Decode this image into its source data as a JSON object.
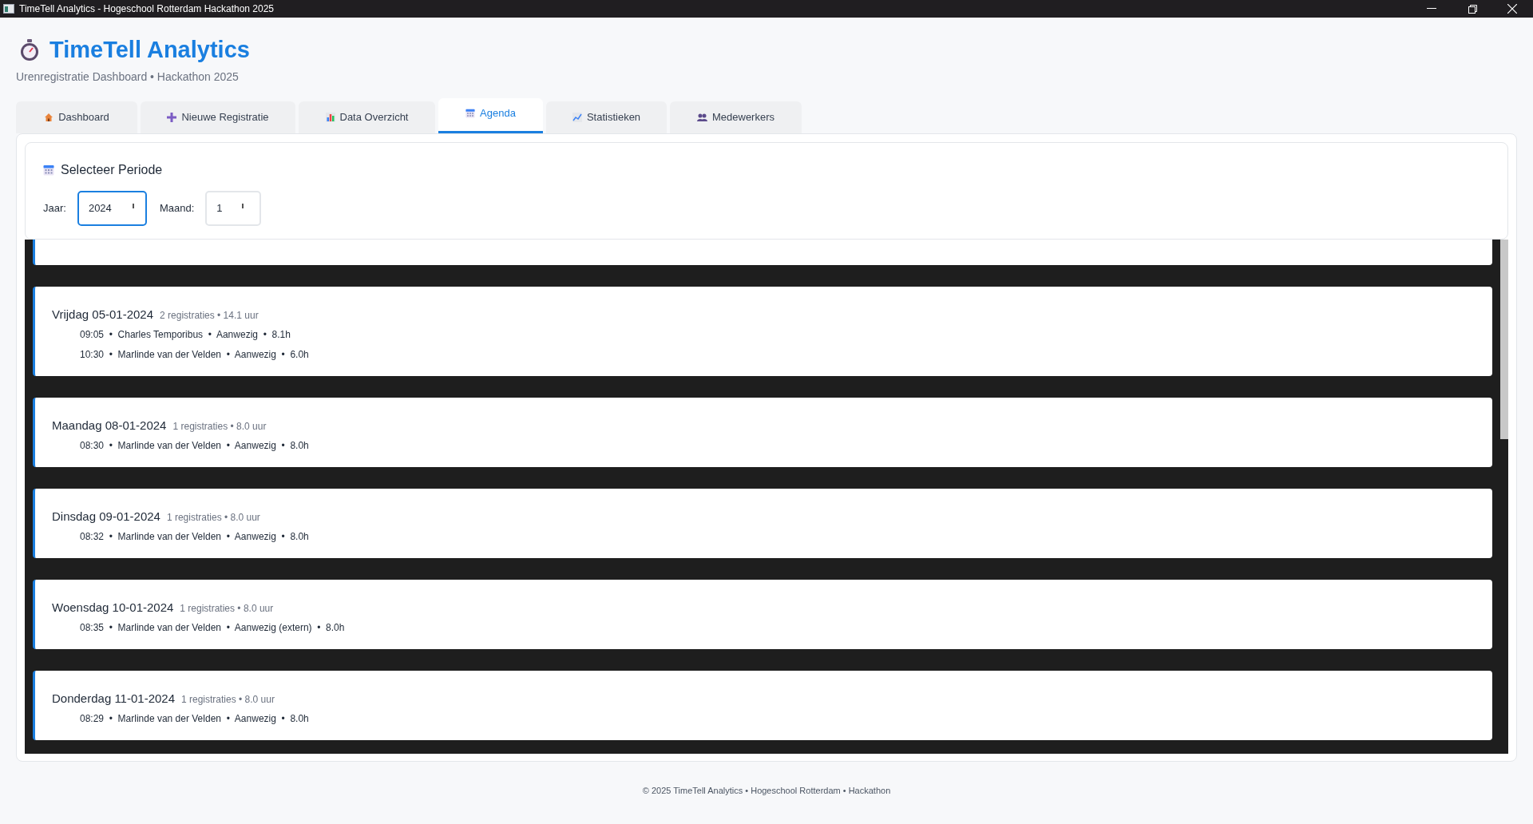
{
  "window": {
    "title": "TimeTell Analytics - Hogeschool Rotterdam Hackathon 2025"
  },
  "header": {
    "title": "TimeTell Analytics",
    "subtitle": "Urenregistratie Dashboard • Hackathon 2025"
  },
  "tabs": [
    {
      "label": "Dashboard",
      "kind": "house",
      "selected": false
    },
    {
      "label": "Nieuwe Registratie",
      "kind": "plus",
      "selected": false
    },
    {
      "label": "Data Overzicht",
      "kind": "bars",
      "selected": false
    },
    {
      "label": "Agenda",
      "kind": "calendar",
      "selected": true
    },
    {
      "label": "Statistieken",
      "kind": "trend",
      "selected": false
    },
    {
      "label": "Medewerkers",
      "kind": "people",
      "selected": false
    }
  ],
  "period": {
    "title": "Selecteer Periode",
    "year_label": "Jaar:",
    "year": "2024",
    "month_label": "Maand:",
    "month": "1",
    "year_focused": true,
    "month_focused": false
  },
  "days": [
    {
      "title": "Vrijdag 05-01-2024",
      "summary": "2 registraties • 14.1 uur",
      "entries": [
        "09:05  •  Charles Temporibus  •  Aanwezig  •  8.1h",
        "10:30  •  Marlinde van der Velden  •  Aanwezig  •  6.0h"
      ]
    },
    {
      "title": "Maandag 08-01-2024",
      "summary": "1 registraties • 8.0 uur",
      "entries": [
        "08:30  •  Marlinde van der Velden  •  Aanwezig  •  8.0h"
      ]
    },
    {
      "title": "Dinsdag 09-01-2024",
      "summary": "1 registraties • 8.0 uur",
      "entries": [
        "08:32  •  Marlinde van der Velden  •  Aanwezig  •  8.0h"
      ]
    },
    {
      "title": "Woensdag 10-01-2024",
      "summary": "1 registraties • 8.0 uur",
      "entries": [
        "08:35  •  Marlinde van der Velden  •  Aanwezig (extern)  •  8.0h"
      ]
    },
    {
      "title": "Donderdag 11-01-2024",
      "summary": "1 registraties • 8.0 uur",
      "entries": [
        "08:29  •  Marlinde van der Velden  •  Aanwezig  •  8.0h"
      ]
    }
  ],
  "footer": "© 2025 TimeTell Analytics • Hogeschool Rotterdam • Hackathon"
}
